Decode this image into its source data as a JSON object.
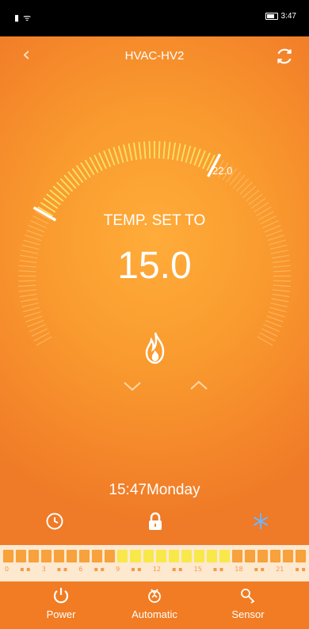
{
  "statusbar": {
    "left": "▮ ᯤ",
    "right": "3:47"
  },
  "header": {
    "title": "HVAC-HV2",
    "back_icon": "chevron-left-icon",
    "refresh_icon": "refresh-icon"
  },
  "dial": {
    "label": "TEMP. SET TO",
    "set_temp": "15.0",
    "max_label": "22.0",
    "mode_icon": "flame-icon"
  },
  "controls": {
    "down_icon": "chevron-down-icon",
    "up_icon": "chevron-up-icon"
  },
  "clock": {
    "text": "15:47Monday"
  },
  "row_icons": [
    "clock-icon",
    "lock-icon",
    "snowflake-icon"
  ],
  "timeline": {
    "ticks": [
      "0",
      "3",
      "6",
      "9",
      "12",
      "15",
      "18",
      "21"
    ],
    "active_blocks": [
      9,
      10,
      11,
      12,
      13,
      14,
      15,
      16,
      17
    ]
  },
  "bottom_nav": [
    {
      "label": "Power",
      "icon": "power-icon"
    },
    {
      "label": "Automatic",
      "icon": "automatic-icon"
    },
    {
      "label": "Sensor",
      "icon": "sensor-icon"
    }
  ],
  "colors": {
    "accent": "#f58a2b",
    "active_block": "#f8e84a",
    "snowflake": "#6fb6ff"
  }
}
